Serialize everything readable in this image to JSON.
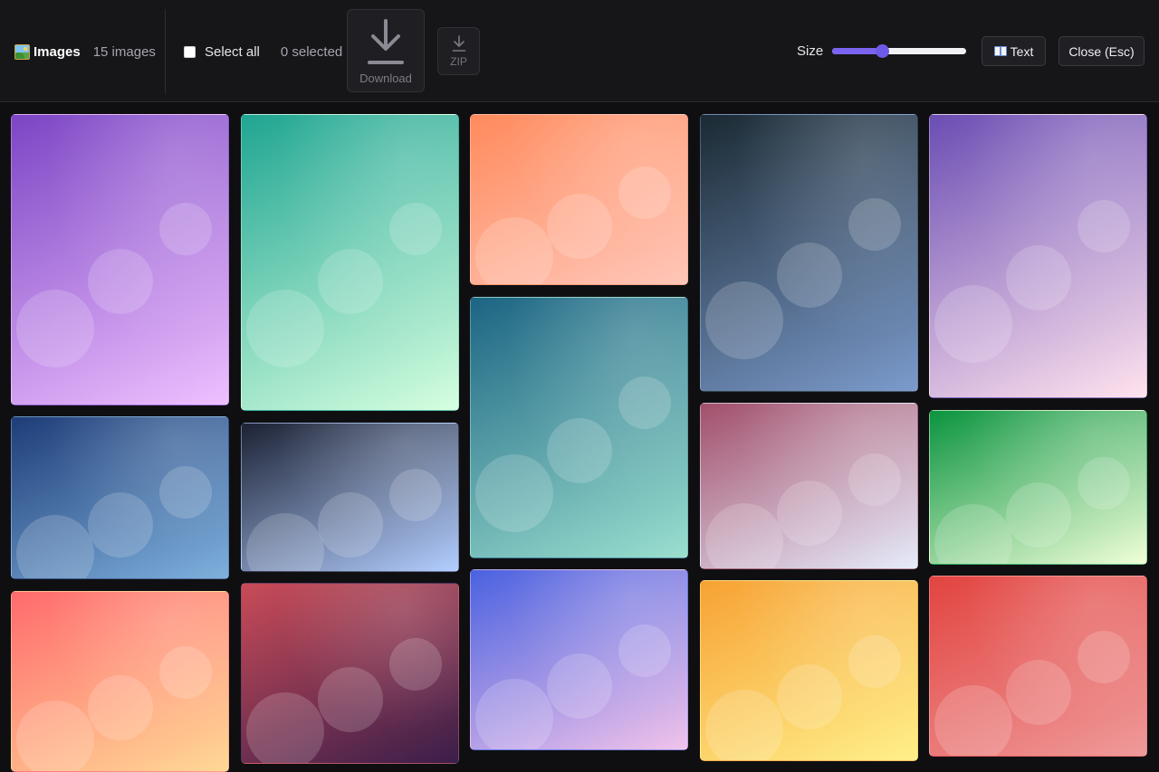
{
  "toolbar": {
    "title": "Images",
    "image_count": "15 images",
    "select_all_label": "Select all",
    "selected_count": "0 selected",
    "download_label": "Download",
    "zip_label": "ZIP",
    "size_label": "Size",
    "size_value": 0.37,
    "text_button_label": "Text",
    "close_button_label": "Close (Esc)",
    "accent_color": "#7a63f0"
  },
  "gallery": {
    "images": [
      {
        "name": "image-1",
        "from": "#7b45c4",
        "to": "#efc0ff"
      },
      {
        "name": "image-2",
        "from": "#1e3d78",
        "to": "#7fb1dd"
      },
      {
        "name": "image-3",
        "from": "#ff6a6d",
        "to": "#ffd996"
      },
      {
        "name": "image-4",
        "from": "#1fa592",
        "to": "#d6ffe0"
      },
      {
        "name": "image-5",
        "from": "#1c2234",
        "to": "#b3ceff"
      },
      {
        "name": "image-6",
        "from": "#c94b57",
        "to": "#3a1e4a"
      },
      {
        "name": "image-7",
        "from": "#ff8a5c",
        "to": "#ffc7b9"
      },
      {
        "name": "image-8",
        "from": "#1c6483",
        "to": "#9bdfcf"
      },
      {
        "name": "image-9",
        "from": "#4a62e0",
        "to": "#f1c3ea"
      },
      {
        "name": "image-10",
        "from": "#1b2a33",
        "to": "#7c9bcc"
      },
      {
        "name": "image-11",
        "from": "#a24f6b",
        "to": "#e6ecfb"
      },
      {
        "name": "image-12",
        "from": "#f7a234",
        "to": "#fff08a"
      },
      {
        "name": "image-13",
        "from": "#6a4db3",
        "to": "#ffe3ee"
      },
      {
        "name": "image-14",
        "from": "#0b9440",
        "to": "#f0ffd9"
      },
      {
        "name": "image-15",
        "from": "#e24440",
        "to": "#ef9a9a"
      }
    ]
  }
}
